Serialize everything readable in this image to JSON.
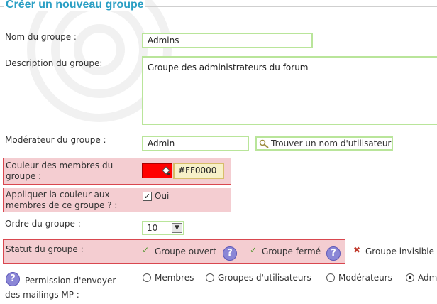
{
  "title": "Créer un nouveau groupe",
  "fields": {
    "name_label": "Nom du groupe :",
    "name_value": "Admins",
    "description_label": "Description du groupe:",
    "description_value": "Groupe des administrateurs du forum",
    "moderator_label": "Modérateur du groupe :",
    "moderator_value": "Admin",
    "find_user_label": "Trouver un nom d'utilisateur",
    "color_label": "Couleur des membres du groupe :",
    "color_value": "#FF0000",
    "apply_color_label": "Appliquer la couleur aux membres de ce groupe ? :",
    "apply_color_option": "Oui",
    "order_label": "Ordre du groupe :",
    "order_value": "10",
    "status_label": "Statut du groupe :",
    "status_options": [
      "Groupe ouvert",
      "Groupe fermé",
      "Groupe invisible"
    ],
    "permission_label": "Permission d'envoyer des mailings MP :",
    "permission_options": [
      "Membres",
      "Groupes d'utilisateurs",
      "Modérateurs",
      "Adm"
    ]
  },
  "help_symbol": "?",
  "colors": {
    "accent": "#2a9fc4",
    "highlight_bg": "#f4cdd1",
    "highlight_border": "#d9474f",
    "input_border": "#b9e59a"
  },
  "icons": [
    "check-icon",
    "help-icon",
    "magnifier-icon",
    "x-icon",
    "radio-icon"
  ]
}
